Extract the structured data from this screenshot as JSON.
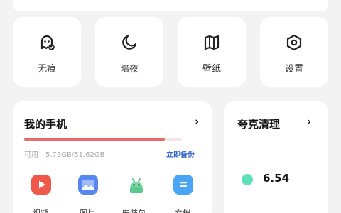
{
  "quick_tiles": [
    {
      "label": "无痕",
      "icon": "ghost-incognito-icon"
    },
    {
      "label": "暗夜",
      "icon": "moon-icon"
    },
    {
      "label": "壁纸",
      "icon": "map-wallpaper-icon"
    },
    {
      "label": "设置",
      "icon": "hex-gear-icon"
    }
  ],
  "my_phone": {
    "title": "我的手机",
    "chevron": "›",
    "storage_text": "可用：5.73GB/51.62GB",
    "storage_used_fraction": 0.89,
    "backup_label": "立即备份",
    "apps": [
      {
        "label": "视频",
        "icon": "video-play-icon",
        "color": "#f0584a"
      },
      {
        "label": "图片",
        "icon": "image-icon",
        "color": "#5a86f0"
      },
      {
        "label": "安装包",
        "icon": "android-icon",
        "color": "#5cc98e"
      },
      {
        "label": "文档",
        "icon": "document-icon",
        "color": "#4aa6f5"
      }
    ]
  },
  "cleaner": {
    "title": "夸克清理",
    "chevron": "›",
    "value": "6.54",
    "dot_color": "#5ee0b7"
  },
  "colors": {
    "accent_red": "#e76b66",
    "link_blue": "#3366cc"
  }
}
